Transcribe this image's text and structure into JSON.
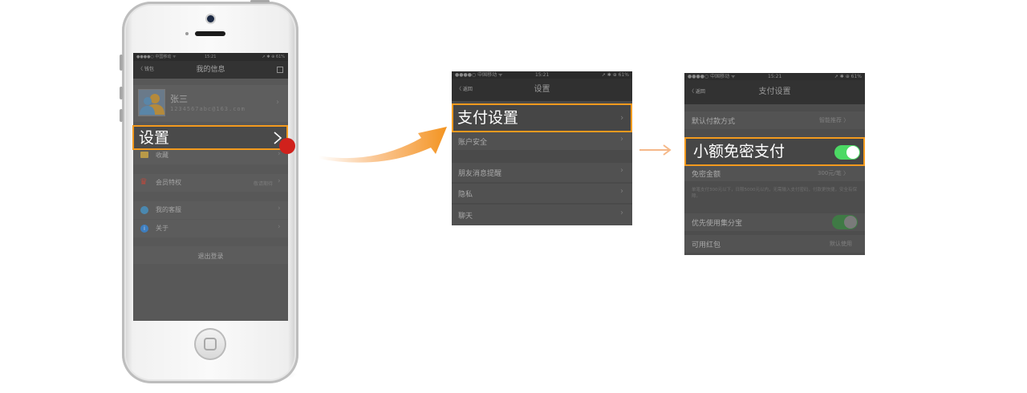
{
  "phone": {
    "status": {
      "carrier": "●●●●○ 中国移动 ᯤ",
      "time": "15:21",
      "battery": "➚ ✱ ⊕ 61%"
    },
    "navbar": {
      "back_label": "〈 钱包",
      "title": "我的信息"
    },
    "profile": {
      "name": "张三",
      "email": "1234567abc@163.com"
    },
    "highlight_label": "设置",
    "menu_items": [
      {
        "label": "收藏",
        "value": ""
      },
      {
        "label": "会员特权",
        "value": "敬请期待"
      },
      {
        "label": "我的客服",
        "value": ""
      },
      {
        "label": "关于",
        "value": ""
      }
    ],
    "logout_label": "退出登录"
  },
  "settings_screen": {
    "status": {
      "carrier": "●●●●○ 中国移动 ᯤ",
      "time": "15:21",
      "battery": "➚ ✱ ⊕ 61%"
    },
    "navbar": {
      "back_label": "〈 返回",
      "title": "设置"
    },
    "highlight_label": "支付设置",
    "items": [
      {
        "label": "账户安全"
      },
      {
        "label": "朋友消息提醒"
      },
      {
        "label": "隐私"
      },
      {
        "label": "聊天"
      }
    ]
  },
  "payment_screen": {
    "status": {
      "carrier": "●●●●○ 中国移动 ᯤ",
      "time": "15:21",
      "battery": "➚ ✱ ⊕ 61%"
    },
    "navbar": {
      "back_label": "〈 返回",
      "title": "支付设置"
    },
    "default_pay": {
      "label": "默认付款方式",
      "value": "智能推荐 〉"
    },
    "highlight_label": "小额免密支付",
    "limit": {
      "label": "免密金额",
      "value": "300元/笔 〉"
    },
    "note": "单笔支付300元以下，日限5000元以内，无需输入支付密码，付款更快捷，安全有保障。",
    "priority": {
      "label": "优先使用集分宝"
    },
    "red_packet": {
      "label": "可用红包",
      "value": "默认使用"
    }
  },
  "colors": {
    "accent": "#f39a1e",
    "tap_dot": "#d0211c",
    "toggle_on": "#4cd964"
  }
}
